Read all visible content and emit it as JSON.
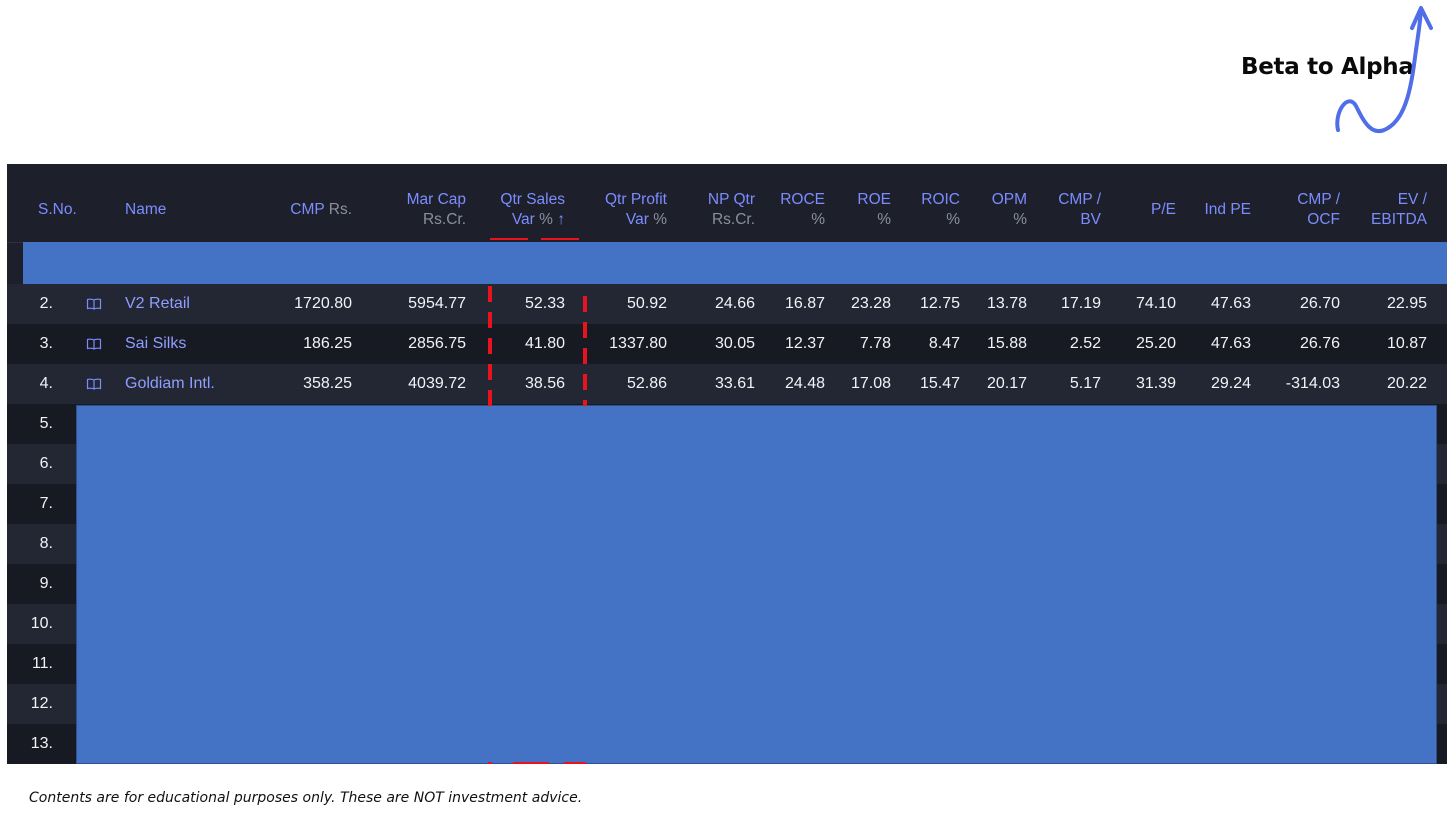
{
  "brand": {
    "title": "Beta to Alpha"
  },
  "table": {
    "headers": {
      "sno": "S.No.",
      "name": "Name",
      "cmp": {
        "main": "CMP",
        "unit": "Rs."
      },
      "mcap": {
        "main": "Mar Cap",
        "unit": "Rs.Cr."
      },
      "qsales": {
        "main": "Qtr Sales",
        "main2": "Var",
        "unit": "%",
        "sort": "↑"
      },
      "qprofit": {
        "main": "Qtr Profit",
        "main2": "Var",
        "unit": "%"
      },
      "npqtr": {
        "main": "NP Qtr",
        "unit": "Rs.Cr."
      },
      "roce": {
        "main": "ROCE",
        "unit": "%"
      },
      "roe": {
        "main": "ROE",
        "unit": "%"
      },
      "roic": {
        "main": "ROIC",
        "unit": "%"
      },
      "opm": {
        "main": "OPM",
        "unit": "%"
      },
      "cmpbv": {
        "main": "CMP /",
        "main2": "BV"
      },
      "pe": {
        "main": "P/E"
      },
      "indpe": {
        "main": "Ind PE"
      },
      "cmpocf": {
        "main": "CMP /",
        "main2": "OCF"
      },
      "evebitda": {
        "main": "EV /",
        "main2": "EBITDA"
      }
    },
    "rows": [
      {
        "sno": "2.",
        "name": "V2 Retail",
        "cmp": "1720.80",
        "mcap": "5954.77",
        "qsales": "52.33",
        "qprofit": "50.92",
        "npqtr": "24.66",
        "roce": "16.87",
        "roe": "23.28",
        "roic": "12.75",
        "opm": "13.78",
        "cmpbv": "17.19",
        "pe": "74.10",
        "indpe": "47.63",
        "cmpocf": "26.70",
        "evebitda": "22.95"
      },
      {
        "sno": "3.",
        "name": "Sai Silks",
        "cmp": "186.25",
        "mcap": "2856.75",
        "qsales": "41.80",
        "qprofit": "1337.80",
        "npqtr": "30.05",
        "roce": "12.37",
        "roe": "7.78",
        "roic": "8.47",
        "opm": "15.88",
        "cmpbv": "2.52",
        "pe": "25.20",
        "indpe": "47.63",
        "cmpocf": "26.76",
        "evebitda": "10.87"
      },
      {
        "sno": "4.",
        "name": "Goldiam Intl.",
        "cmp": "358.25",
        "mcap": "4039.72",
        "qsales": "38.56",
        "qprofit": "52.86",
        "npqtr": "33.61",
        "roce": "24.48",
        "roe": "17.08",
        "roic": "15.47",
        "opm": "20.17",
        "cmpbv": "5.17",
        "pe": "31.39",
        "indpe": "29.24",
        "cmpocf": "-314.03",
        "evebitda": "20.22"
      }
    ],
    "hidden_row_numbers": [
      "5.",
      "6.",
      "7.",
      "8.",
      "9.",
      "10.",
      "11.",
      "12.",
      "13."
    ]
  },
  "footer": {
    "disclaimer": "Contents are for educational purposes only. These are NOT investment advice."
  },
  "colors": {
    "header_text": "#7c8cff",
    "mask": "#4472c4",
    "highlight": "#e8131c",
    "panel": "#1d202b"
  },
  "icons": {
    "watchlist": "book-icon",
    "brand_arrow": "squiggle-arrow-icon"
  }
}
